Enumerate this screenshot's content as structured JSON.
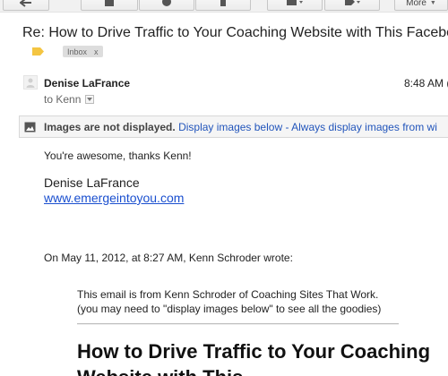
{
  "toolbar": {
    "more_label": "More",
    "icons": [
      "back-arrow-icon",
      "archive-icon",
      "report-spam-icon",
      "delete-icon",
      "move-folder-icon",
      "label-tag-icon"
    ]
  },
  "subject": "Re: How to Drive Traffic to Your Coaching Website with This Facebook",
  "label": {
    "name": "Inbox",
    "remove": "x"
  },
  "message": {
    "sender": "Denise LaFrance",
    "time": "8:48 AM (",
    "to": "to Kenn"
  },
  "images_banner": {
    "bold": "Images are not displayed.",
    "display_link": "Display images below",
    "separator": "-",
    "always_link": "Always display images from wi"
  },
  "body": {
    "greeting": "You're awesome, thanks Kenn!",
    "signature_name": "Denise LaFrance",
    "signature_link": "www.emergeintoyou.com",
    "quote_header": "On May 11, 2012, at 8:27 AM, Kenn Schroder wrote:",
    "quote_line1": "This email is from Kenn Schroder of Coaching Sites That Work.",
    "quote_line2": "(you may need to \"display images below\" to see all the goodies)",
    "headline": "How to Drive Traffic to Your Coaching Website with This"
  },
  "colors": {
    "link": "#2255bb",
    "signature_link": "#1a4fcf",
    "important_marker": "#f4c542",
    "banner_bg": "#f5f5f5"
  }
}
